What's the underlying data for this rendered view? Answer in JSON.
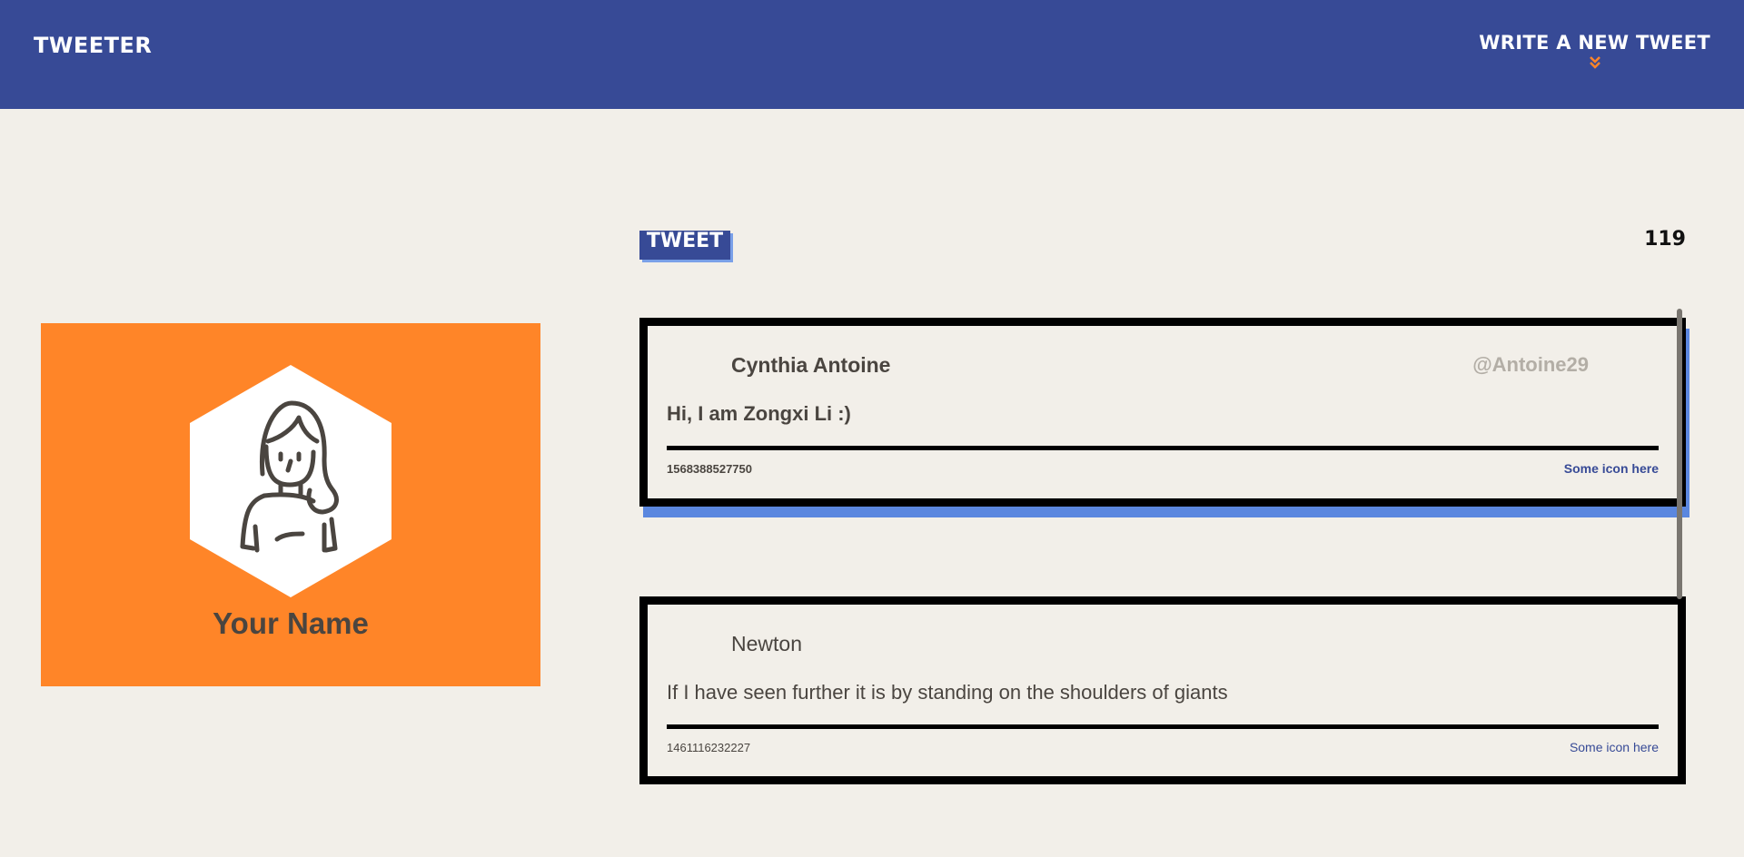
{
  "nav": {
    "brand": "Tweeter",
    "compose_link": "Write a new tweet",
    "chevron_icon": "double-chevron-down-icon",
    "chevron_color": "#ff8528"
  },
  "profile": {
    "name": "Your Name",
    "avatar_icon": "woman-avatar-icon",
    "card_color": "#ff8528"
  },
  "composer": {
    "tweet_button": "Tweet",
    "char_counter": "119"
  },
  "tweets": [
    {
      "author": "Cynthia Antoine",
      "handle": "@Antoine29",
      "text": "Hi, I am Zongxi Li :)",
      "timestamp": "1568388527750",
      "icon_note": "Some icon here"
    },
    {
      "author": "Newton",
      "handle": "",
      "text": "If I have seen further it is by standing on the shoulders of giants",
      "timestamp": "1461116232227",
      "icon_note": "Some icon here"
    }
  ],
  "colors": {
    "nav": "#374a96",
    "background": "#f2efe9",
    "accent_shadow": "#5b87df",
    "link": "#374a96"
  }
}
